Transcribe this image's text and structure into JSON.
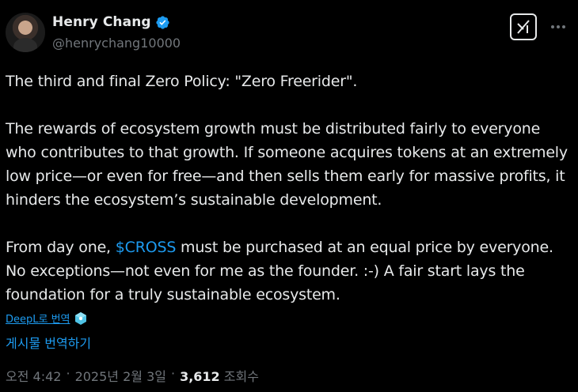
{
  "author": {
    "name": "Henry Chang",
    "handle": "@henrychang10000",
    "verified": true
  },
  "actions": {
    "grok_icon": "grok-icon",
    "more_icon": "more-icon"
  },
  "post": {
    "para1": "The third and final Zero Policy: \"Zero Freerider\".",
    "para2": "The rewards of ecosystem growth must be distributed fairly to everyone who contributes to that growth. If someone acquires tokens at an extremely low price—or even for free—and then sells them early for massive profits, it hinders the ecosystem’s sustainable development.",
    "para3_before": "From day one, ",
    "cashtag": "$CROSS",
    "para3_after": " must be purchased at an equal price by everyone. No exceptions—not even for me as the founder. :-) A fair start lays the foundation for a truly sustainable ecosystem."
  },
  "translate": {
    "deepl_label": "DeepL로 번역",
    "post_label": "게시물 번역하기"
  },
  "meta": {
    "time": "오전 4:42",
    "sep1": "·",
    "date": "2025년 2월 3일",
    "sep2": "·",
    "views": "3,612",
    "views_label": "조회수"
  },
  "colors": {
    "background": "#000000",
    "text": "#e7e9ea",
    "muted": "#71767b",
    "accent": "#1d9bf0"
  }
}
